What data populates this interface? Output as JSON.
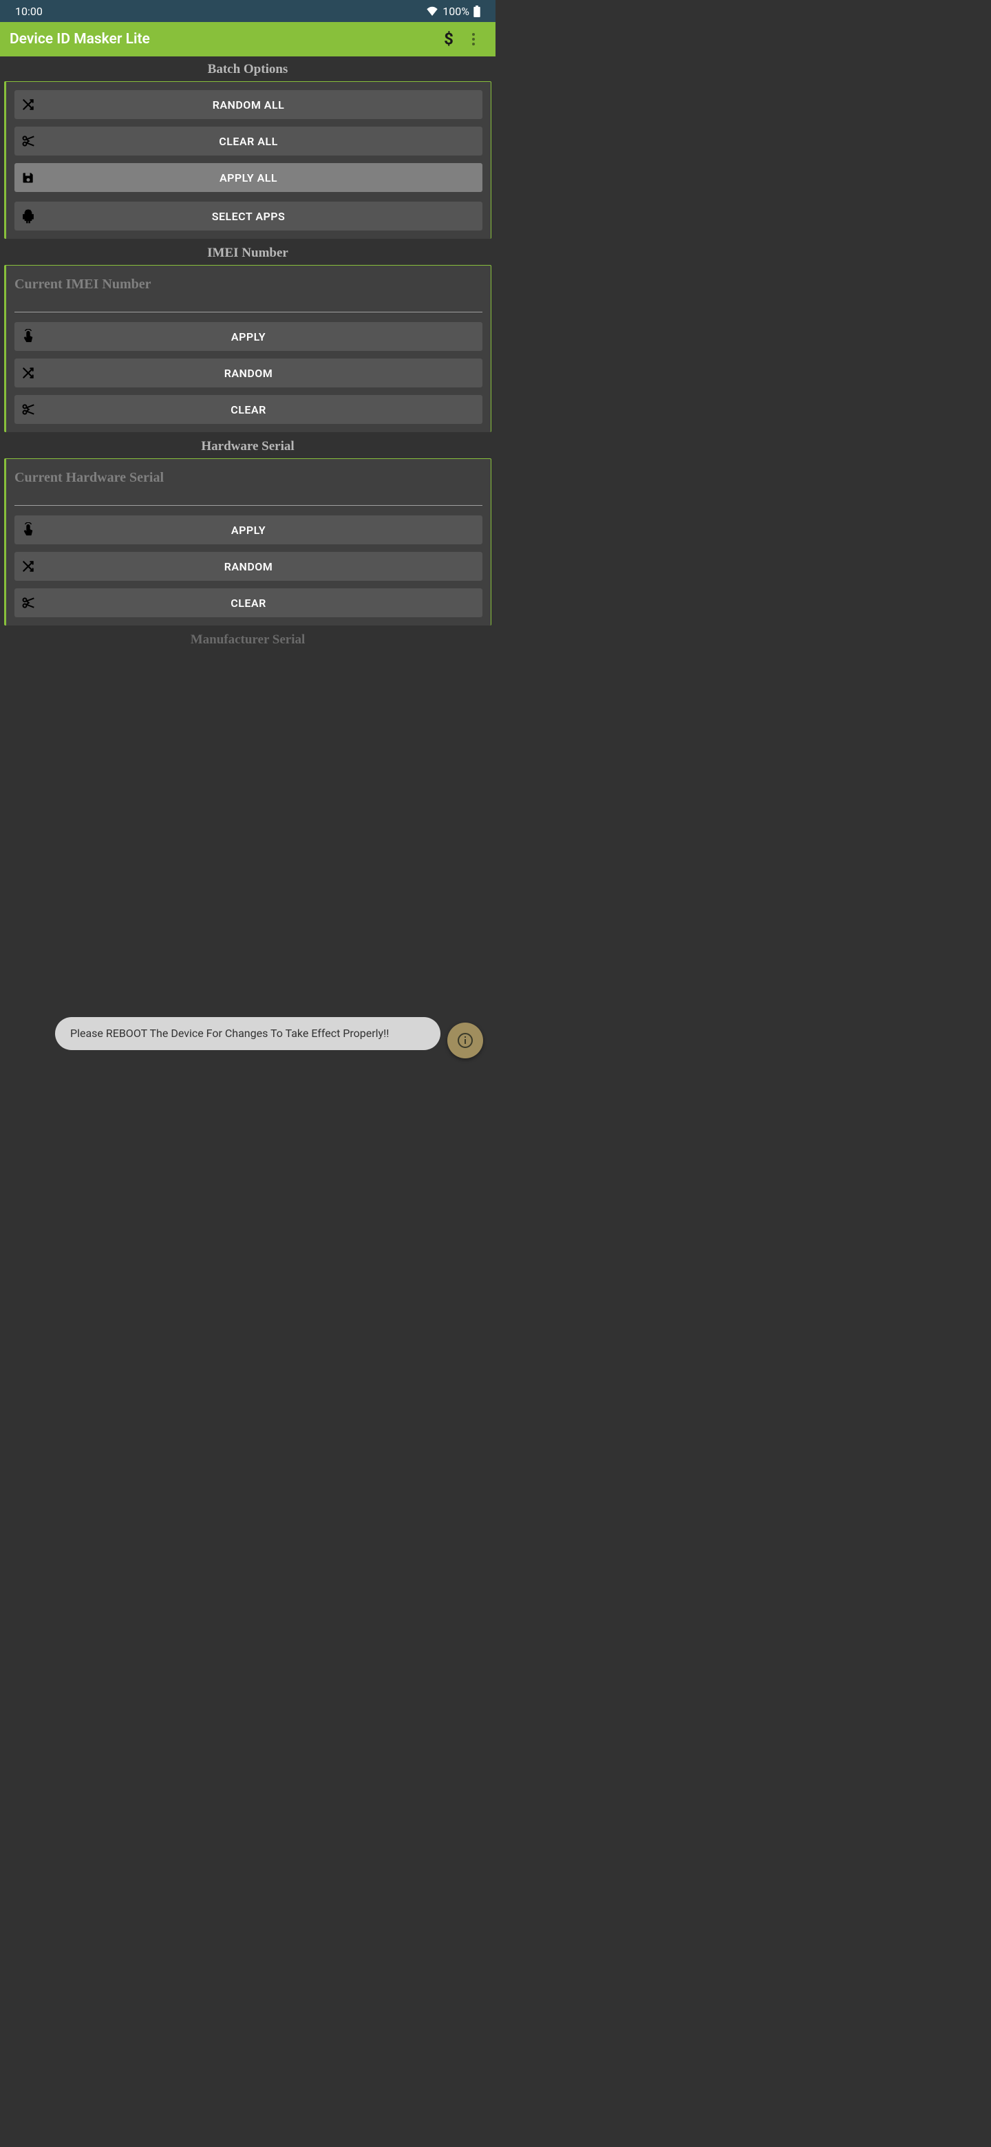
{
  "status": {
    "time": "10:00",
    "battery": "100%"
  },
  "app": {
    "title": "Device ID Masker Lite"
  },
  "sections": {
    "batch": {
      "title": "Batch Options",
      "random_all": "RANDOM ALL",
      "clear_all": "CLEAR ALL",
      "apply_all": "APPLY ALL",
      "select_apps": "SELECT APPS"
    },
    "imei": {
      "title": "IMEI Number",
      "placeholder": "Current IMEI Number",
      "apply": "APPLY",
      "random": "RANDOM",
      "clear": "CLEAR"
    },
    "hwserial": {
      "title": "Hardware Serial",
      "placeholder": "Current Hardware Serial",
      "apply": "APPLY",
      "random": "RANDOM",
      "clear": "CLEAR"
    },
    "mfserial": {
      "title": "Manufacturer Serial"
    }
  },
  "toast": "Please REBOOT The Device For Changes To Take Effect Properly!!"
}
